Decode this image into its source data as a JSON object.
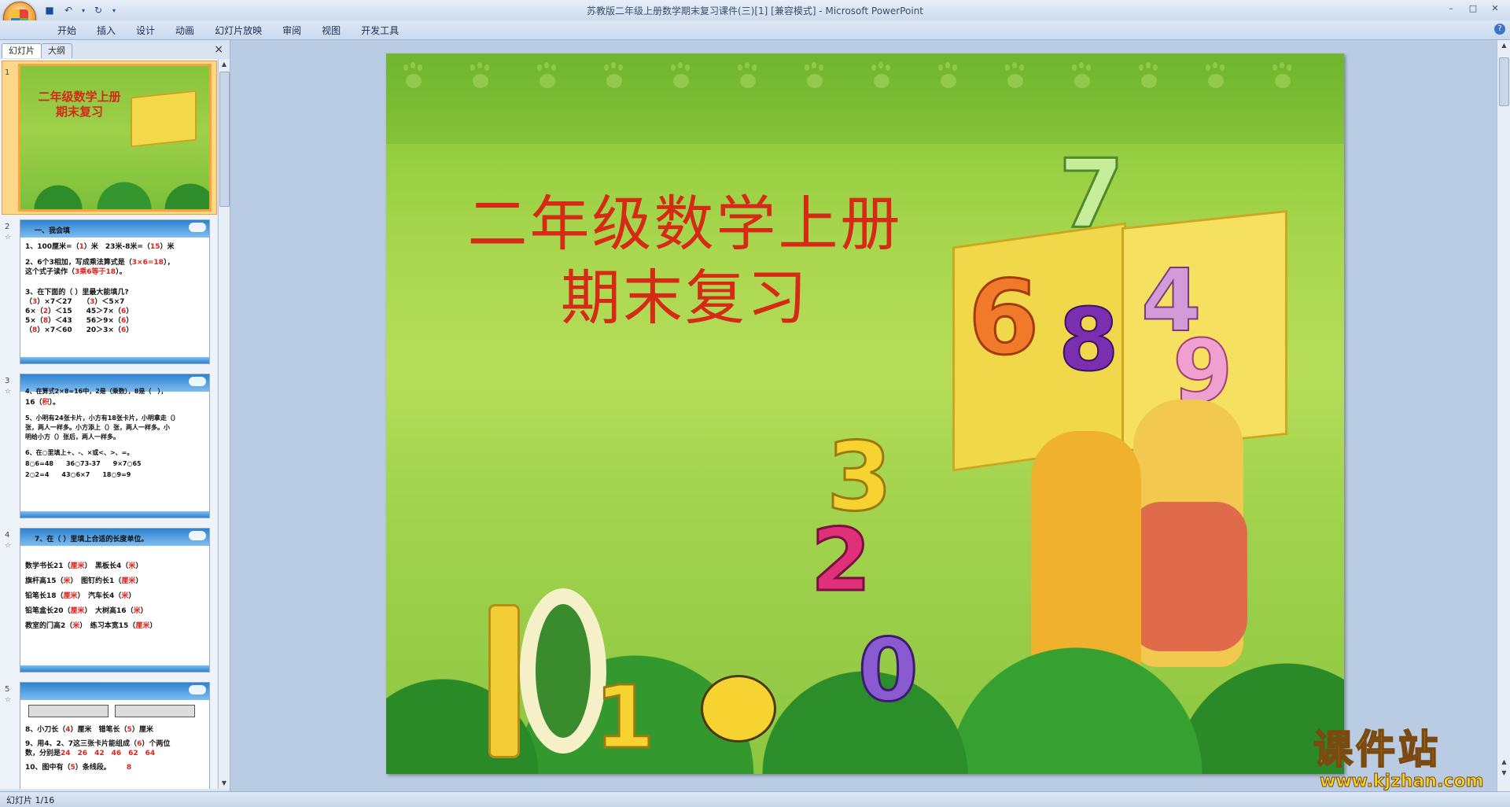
{
  "window": {
    "title": "苏教版二年级上册数学期末复习课件(三)[1] [兼容模式] - Microsoft PowerPoint"
  },
  "ribbon": {
    "tabs": [
      "开始",
      "插入",
      "设计",
      "动画",
      "幻灯片放映",
      "审阅",
      "视图",
      "开发工具"
    ]
  },
  "panel": {
    "tabs": [
      "幻灯片",
      "大纲"
    ],
    "close": "×"
  },
  "thumbnails": [
    {
      "num": "1",
      "title_lines": [
        "二年级数学上册",
        "期末复习"
      ]
    },
    {
      "num": "2",
      "header": "一、我会填",
      "lines": [
        [
          "1、100厘米=（",
          "1",
          "）米　23米-8米=（",
          "15",
          "）米"
        ],
        [
          "2、6个3相加，写成乘法算式是（",
          "3×6=18",
          "），"
        ],
        [
          "这个式子读作（",
          "3乘6等于18",
          "）。"
        ],
        [
          "3、在下面的（ ）里最大能填几?"
        ],
        [
          "（",
          "3",
          "）×7＜27　　（",
          "3",
          "）＜5×7"
        ],
        [
          "6×（",
          "2",
          "）＜15　　45＞7×（",
          "6",
          "）"
        ],
        [
          "5×（",
          "8",
          "）＜43　　56＞9×（",
          "6",
          "）"
        ],
        [
          "（",
          "8",
          "）×7＜60　　20＞3×（",
          "6",
          "）"
        ]
      ]
    },
    {
      "num": "3",
      "header": "4、在算式2×8=16中，2是（乘数），8是（　），",
      "lines": [
        [
          "16（",
          "积",
          "）。"
        ],
        [
          "5、小明有24张卡片，小方有18张卡片，小明拿走（）"
        ],
        [
          "张，两人一样多。小方添上（）张，两人一样多。小"
        ],
        [
          "明给小方（）张后，两人一样多。"
        ],
        [
          "6、在○里填上+、-、×或<、>、=。"
        ],
        [
          "8○6=48　　36○73-37　　9×7○65"
        ],
        [
          "2○2=4　　43○6×7　　18○9=9"
        ]
      ]
    },
    {
      "num": "4",
      "header": "7、在（ ）里填上合适的长度单位。",
      "lines": [
        [
          "数学书长21（",
          "厘米",
          "）　黑板长4（",
          "米",
          "）"
        ],
        [
          "旗杆高15（",
          "米",
          "）　图钉约长1（",
          "厘米",
          "）"
        ],
        [
          "铅笔长18（",
          "厘米",
          "）　汽车长4（",
          "米",
          "）"
        ],
        [
          "铅笔盒长20（",
          "厘米",
          "）　大树高16（",
          "米",
          "）"
        ],
        [
          "教室的门高2（",
          "米",
          "）　练习本宽15（",
          "厘米",
          "）"
        ]
      ]
    },
    {
      "num": "5",
      "lines": [
        [
          "8、小刀长（",
          "4",
          "）厘米　错笔长（",
          "5",
          "）厘米"
        ],
        [
          "9、用4、2、7这三张卡片能组成（",
          "6",
          "）个两位"
        ],
        [
          "数，分别是",
          "24　26　42　46　62　64"
        ],
        [
          "10、图中有（",
          "5",
          "）条线段。",
          "8"
        ]
      ]
    }
  ],
  "slide": {
    "title_lines": [
      "二年级数学上册",
      "期末复习"
    ],
    "numbers": [
      "7",
      "6",
      "8",
      "4",
      "9",
      "3",
      "2",
      "1",
      "0"
    ]
  },
  "status": {
    "text": "幻灯片 1/16"
  },
  "watermark": {
    "text": "课件站",
    "url": "www.kjzhan.com"
  },
  "colors": {
    "accent_red": "#d72a16",
    "slide_green": "#8fcb3c",
    "selection": "#f5a53a"
  }
}
